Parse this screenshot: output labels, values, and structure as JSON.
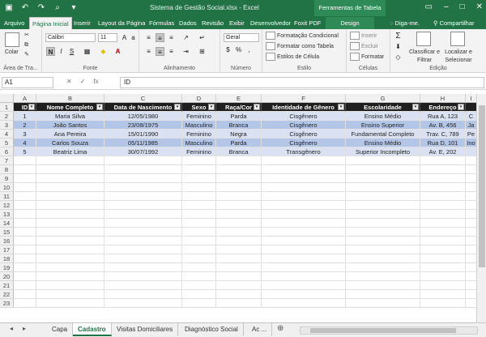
{
  "titlebar": {
    "window_title": "Sistema de Gestão Social.xlsx - Excel",
    "tools_title": "Ferramentas de Tabela",
    "qat": [
      "save-icon",
      "undo-icon",
      "redo-icon",
      "print-preview-icon",
      "customize-icon"
    ]
  },
  "tabs": {
    "items": [
      "Arquivo",
      "Página Inicial",
      "Inserir",
      "Layout da Página",
      "Fórmulas",
      "Dados",
      "Revisão",
      "Exibir",
      "Desenvolvedor",
      "Foxit PDF",
      "Design"
    ],
    "active": "Página Inicial",
    "tell_me": "Diga-me.",
    "share": "Compartilhar"
  },
  "ribbon": {
    "clipboard": {
      "label": "Área de Tra...",
      "paste": "Colar"
    },
    "font": {
      "label": "Fonte",
      "font_name": "Calibri",
      "font_size": "11"
    },
    "alignment": {
      "label": "Alinhamento"
    },
    "number": {
      "label": "Número",
      "format": "Geral"
    },
    "styles": {
      "label": "Estilo",
      "conditional": "Formatação Condicional",
      "as_table": "Formatar como Tabela",
      "cell_styles": "Estilos de Célula"
    },
    "cells": {
      "label": "Células",
      "insert": "Inserir",
      "delete": "Excluir",
      "format": "Formatar"
    },
    "editing": {
      "label": "Edição",
      "sort": "Classificar e Filtrar",
      "find": "Localizar e Selecionar"
    }
  },
  "formula_bar": {
    "name_box": "A1",
    "content": "ID"
  },
  "grid": {
    "columns": [
      "A",
      "B",
      "C",
      "D",
      "E",
      "F",
      "G",
      "H",
      "I"
    ],
    "headers": [
      "ID",
      "Nome Completo",
      "Data de Nascimento",
      "Sexo",
      "Raça/Cor",
      "Identidade de Gênero",
      "Escolaridade",
      "Endereço",
      ""
    ],
    "rows": [
      [
        "1",
        "Maria Silva",
        "12/05/1980",
        "Feminino",
        "Parda",
        "Cisgênero",
        "Ensino Médio",
        "Rua A, 123",
        "C"
      ],
      [
        "2",
        "João Santos",
        "23/08/1975",
        "Masculino",
        "Branca",
        "Cisgênero",
        "Ensino Superior",
        "Av. B, 456",
        "Ja"
      ],
      [
        "3",
        "Ana Pereira",
        "15/01/1990",
        "Feminino",
        "Negra",
        "Cisgênero",
        "Fundamental Completo",
        "Trav. C, 789",
        "Pe"
      ],
      [
        "4",
        "Carlos Souza",
        "05/11/1985",
        "Masculino",
        "Parda",
        "Cisgênero",
        "Ensino Médio",
        "Rua D, 101",
        "Ino"
      ],
      [
        "5",
        "Beatriz Lima",
        "30/07/1992",
        "Feminino",
        "Branca",
        "Transgênero",
        "Superior Incompleto",
        "Av. E, 202",
        ""
      ]
    ],
    "row_numbers": [
      "1",
      "2",
      "3",
      "4",
      "5",
      "6",
      "7",
      "8",
      "9",
      "10",
      "11",
      "12",
      "13",
      "14",
      "15",
      "16",
      "17",
      "18",
      "19",
      "20",
      "21",
      "22",
      "23"
    ]
  },
  "sheets": {
    "items": [
      "Capa",
      "Cadastro",
      "Visitas Domiciliares",
      "Diagnóstico Social",
      "Ac ..."
    ],
    "active": "Cadastro"
  }
}
